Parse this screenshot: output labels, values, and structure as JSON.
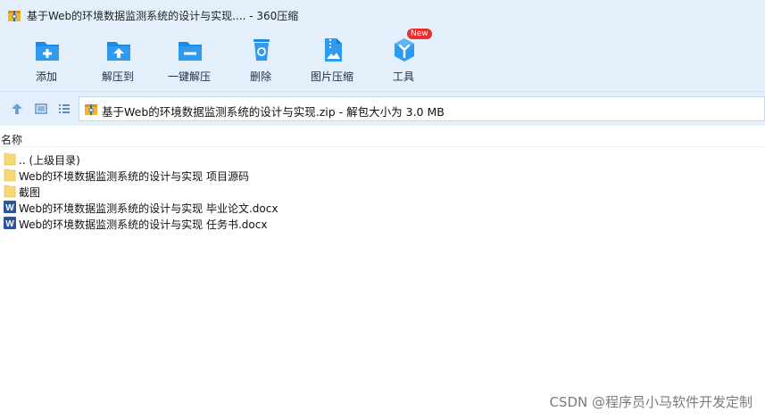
{
  "window": {
    "title": "基于Web的环境数据监测系统的设计与实现.... - 360压缩"
  },
  "toolbar": {
    "items": [
      {
        "label": "添加",
        "icon": "add-icon"
      },
      {
        "label": "解压到",
        "icon": "extract-to-icon"
      },
      {
        "label": "一键解压",
        "icon": "one-click-extract-icon"
      },
      {
        "label": "删除",
        "icon": "recycle-bin-icon"
      },
      {
        "label": "图片压缩",
        "icon": "image-compress-icon"
      },
      {
        "label": "工具",
        "icon": "tools-icon",
        "badge": "New"
      }
    ]
  },
  "address": {
    "path": "基于Web的环境数据监测系统的设计与实现.zip - 解包大小为 3.0 MB"
  },
  "columns": {
    "name": "名称"
  },
  "files": [
    {
      "name": ".. (上级目录)",
      "type": "folder"
    },
    {
      "name": "Web的环境数据监测系统的设计与实现 项目源码",
      "type": "folder"
    },
    {
      "name": "截图",
      "type": "folder"
    },
    {
      "name": "Web的环境数据监测系统的设计与实现 毕业论文.docx",
      "type": "word"
    },
    {
      "name": "Web的环境数据监测系统的设计与实现 任务书.docx",
      "type": "word"
    }
  ],
  "watermark": "CSDN @程序员小马软件开发定制",
  "colors": {
    "chrome": "#e3f0fc",
    "icon_blue": "#1f8ae6",
    "folder": "#f8d775",
    "word": "#2b579a",
    "badge": "#e8302e"
  }
}
